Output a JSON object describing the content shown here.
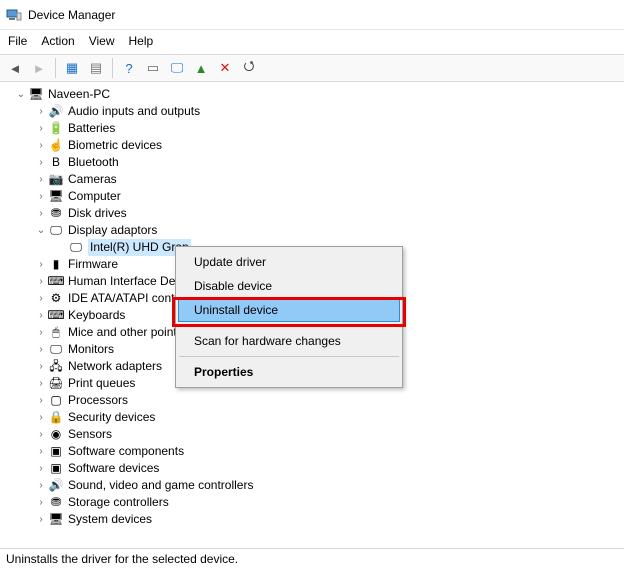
{
  "window": {
    "title": "Device Manager"
  },
  "menubar": [
    "File",
    "Action",
    "View",
    "Help"
  ],
  "toolbar": [
    {
      "name": "back-icon",
      "glyph": "◄",
      "color": "#555"
    },
    {
      "name": "forward-icon",
      "glyph": "►",
      "color": "#bbb"
    },
    {
      "name": "show-hidden-icon",
      "glyph": "▦",
      "color": "#1b70c9"
    },
    {
      "name": "properties-icon",
      "glyph": "▤",
      "color": "#777"
    },
    {
      "name": "help-icon",
      "glyph": "?",
      "color": "#1b70c9"
    },
    {
      "name": "scan-window-icon",
      "glyph": "▭",
      "color": "#666"
    },
    {
      "name": "monitor-icon",
      "glyph": "🖵",
      "color": "#1b70c9"
    },
    {
      "name": "add-legacy-icon",
      "glyph": "▲",
      "color": "#2a8a2a"
    },
    {
      "name": "remove-icon",
      "glyph": "✕",
      "color": "#d11"
    },
    {
      "name": "update-scan-icon",
      "glyph": "⭯",
      "color": "#333"
    }
  ],
  "root": {
    "label": "Naveen-PC"
  },
  "categories": [
    {
      "label": "Audio inputs and outputs",
      "icon": "audio-icon",
      "glyph": "🔊"
    },
    {
      "label": "Batteries",
      "icon": "battery-icon",
      "glyph": "🔋"
    },
    {
      "label": "Biometric devices",
      "icon": "biometric-icon",
      "glyph": "☝"
    },
    {
      "label": "Bluetooth",
      "icon": "bluetooth-icon",
      "glyph": "B"
    },
    {
      "label": "Cameras",
      "icon": "camera-icon",
      "glyph": "📷"
    },
    {
      "label": "Computer",
      "icon": "computer-icon",
      "glyph": "🖥"
    },
    {
      "label": "Disk drives",
      "icon": "disk-icon",
      "glyph": "⛃"
    },
    {
      "label": "Display adaptors",
      "icon": "display-icon",
      "glyph": "🖵",
      "expanded": true,
      "children": [
        {
          "label": "Intel(R) UHD Grap",
          "icon": "gpu-icon",
          "glyph": "🖵",
          "selected": true
        }
      ]
    },
    {
      "label": "Firmware",
      "icon": "firmware-icon",
      "glyph": "▮"
    },
    {
      "label": "Human Interface De",
      "icon": "hid-icon",
      "glyph": "⌨"
    },
    {
      "label": "IDE ATA/ATAPI contr",
      "icon": "ide-icon",
      "glyph": "⚙"
    },
    {
      "label": "Keyboards",
      "icon": "keyboard-icon",
      "glyph": "⌨"
    },
    {
      "label": "Mice and other point",
      "icon": "mouse-icon",
      "glyph": "🖱"
    },
    {
      "label": "Monitors",
      "icon": "monitors-icon",
      "glyph": "🖵"
    },
    {
      "label": "Network adapters",
      "icon": "network-icon",
      "glyph": "🖧"
    },
    {
      "label": "Print queues",
      "icon": "printer-icon",
      "glyph": "🖨"
    },
    {
      "label": "Processors",
      "icon": "cpu-icon",
      "glyph": "▢"
    },
    {
      "label": "Security devices",
      "icon": "security-icon",
      "glyph": "🔒"
    },
    {
      "label": "Sensors",
      "icon": "sensor-icon",
      "glyph": "◉"
    },
    {
      "label": "Software components",
      "icon": "sw-comp-icon",
      "glyph": "▣"
    },
    {
      "label": "Software devices",
      "icon": "sw-dev-icon",
      "glyph": "▣"
    },
    {
      "label": "Sound, video and game controllers",
      "icon": "sound-icon",
      "glyph": "🔊"
    },
    {
      "label": "Storage controllers",
      "icon": "storage-icon",
      "glyph": "⛃"
    },
    {
      "label": "System devices",
      "icon": "system-icon",
      "glyph": "🖥"
    }
  ],
  "context_menu": {
    "items": [
      {
        "label": "Update driver",
        "name": "update-driver"
      },
      {
        "label": "Disable device",
        "name": "disable-device"
      },
      {
        "label": "Uninstall device",
        "name": "uninstall-device",
        "hovered": true,
        "highlighted": true
      },
      {
        "sep": true
      },
      {
        "label": "Scan for hardware changes",
        "name": "scan-hardware"
      },
      {
        "sep": true
      },
      {
        "label": "Properties",
        "name": "properties",
        "bold": true
      }
    ]
  },
  "statusbar": {
    "text": "Uninstalls the driver for the selected device."
  }
}
